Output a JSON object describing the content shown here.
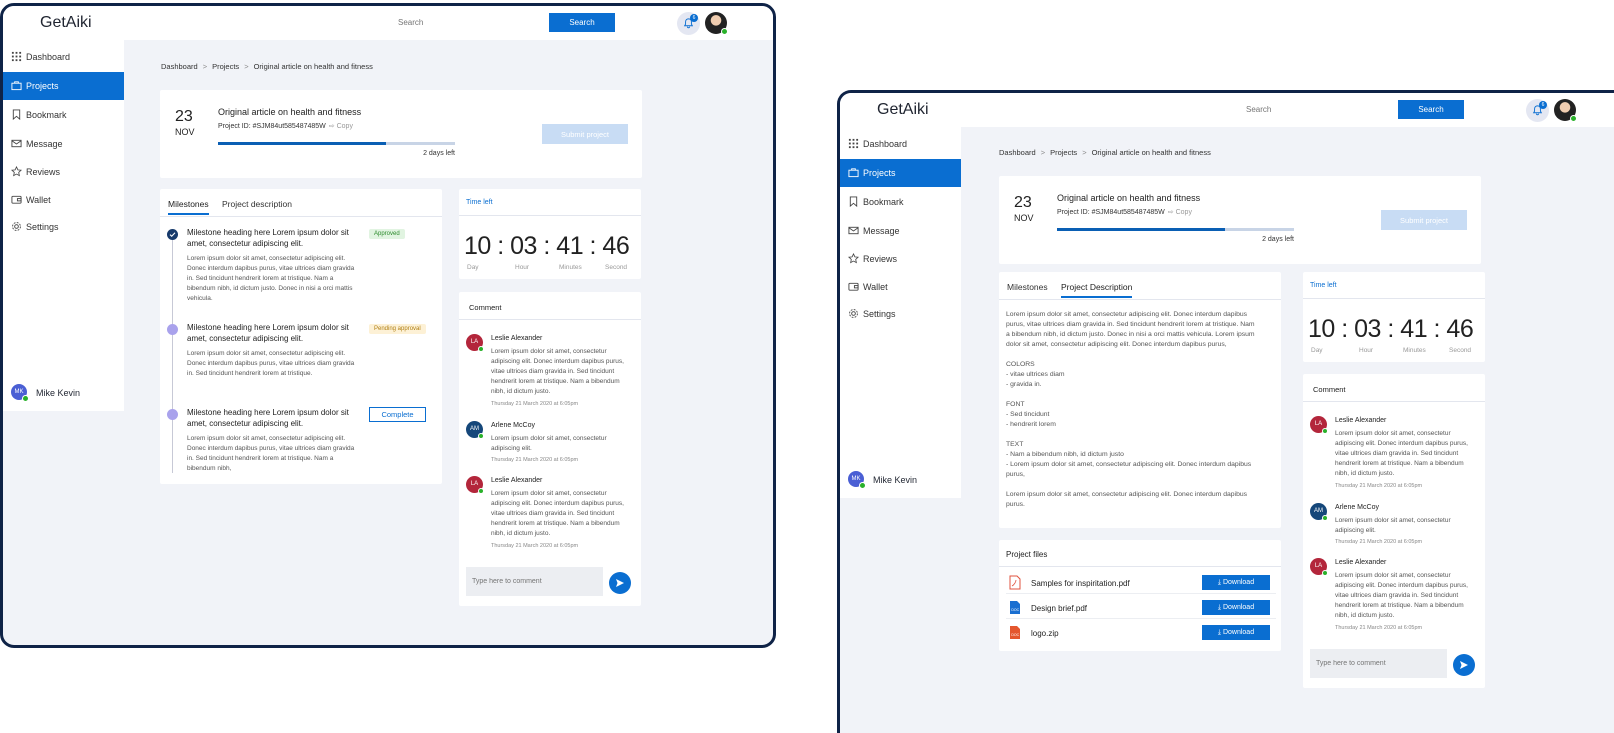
{
  "app": {
    "title": "GetAiki"
  },
  "search": {
    "placeholder": "Search",
    "button": "Search"
  },
  "notifications": {
    "count": "6"
  },
  "sidebar": {
    "items": [
      {
        "label": "Dashboard",
        "icon": "grid-icon"
      },
      {
        "label": "Projects",
        "icon": "briefcase-icon"
      },
      {
        "label": "Bookmark",
        "icon": "bookmark-icon"
      },
      {
        "label": "Message",
        "icon": "mail-icon"
      },
      {
        "label": "Reviews",
        "icon": "star-icon"
      },
      {
        "label": "Wallet",
        "icon": "wallet-icon"
      },
      {
        "label": "Settings",
        "icon": "gear-icon"
      }
    ],
    "user": {
      "initials": "MK",
      "name": "Mike Kevin"
    }
  },
  "breadcrumb": [
    "Dashboard",
    "Projects",
    "Original article on health and fitness"
  ],
  "project": {
    "day": "23",
    "month": "NOV",
    "title": "Original article on health and fitness",
    "id_text": "Project ID: #SJM84ut585487485W",
    "copy_label": "Copy",
    "progress": 0.71,
    "days_left": "2 days left",
    "submit_label": "Submit project"
  },
  "tabs": {
    "milestones": "Milestones",
    "description_left": "Project description",
    "description_right": "Project Description"
  },
  "milestones": [
    {
      "heading": "Milestone heading here Lorem ipsum dolor sit amet, consectetur adipiscing elit.",
      "body": "Lorem ipsum dolor sit amet, consectetur adipiscing elit. Donec interdum dapibus purus, vitae ultrices diam gravida in. Sed tincidunt hendrerit lorem at tristique. Nam a bibendum nibh, id dictum justo. Donec in nisi a orci mattis vehicula.",
      "status": "Approved"
    },
    {
      "heading": "Milestone heading here Lorem ipsum dolor sit amet, consectetur adipiscing elit.",
      "body": "Lorem ipsum dolor sit amet, consectetur adipiscing elit. Donec interdum dapibus purus, vitae ultrices diam gravida in. Sed tincidunt hendrerit lorem at tristique.",
      "status": "Pending approval"
    },
    {
      "heading": "Milestone heading here Lorem ipsum dolor sit amet, consectetur adipiscing elit.",
      "body": "Lorem ipsum dolor sit amet, consectetur adipiscing elit. Donec interdum dapibus purus, vitae ultrices diam gravida in. Sed tincidunt hendrerit lorem at tristique. Nam a bibendum nibh,",
      "action": "Complete"
    }
  ],
  "timer": {
    "title": "Time left",
    "display": "10 : 03 : 41 : 46",
    "labels": [
      "Day",
      "Hour",
      "Minutes",
      "Second"
    ]
  },
  "comments": {
    "title": "Comment",
    "items": [
      {
        "initials": "LA",
        "name": "Leslie Alexander",
        "text": "Lorem ipsum dolor sit amet, consectetur adipiscing elit. Donec interdum dapibus purus, vitae ultrices diam gravida in. Sed tincidunt hendrerit lorem at tristique. Nam a bibendum nibh, id dictum justo.",
        "time": "Thursday 21 March 2020 at 6:05pm"
      },
      {
        "initials": "AM",
        "name": "Arlene McCoy",
        "text": "Lorem ipsum dolor sit amet, consectetur adipiscing elit.",
        "time": "Thursday 21 March 2020 at 6:05pm"
      },
      {
        "initials": "LA",
        "name": "Leslie Alexander",
        "text": "Lorem ipsum dolor sit amet, consectetur adipiscing elit. Donec interdum dapibus purus, vitae ultrices diam gravida in. Sed tincidunt hendrerit lorem at tristique. Nam a bibendum nibh, id dictum justo.",
        "time": "Thursday 21 March 2020 at 6:05pm"
      }
    ],
    "input_placeholder": "Type here to comment"
  },
  "description": {
    "text": "Lorem ipsum dolor sit amet, consectetur adipiscing elit. Donec interdum dapibus purus, vitae ultrices diam gravida in. Sed tincidunt hendrerit lorem at tristique. Nam a bibendum nibh, id dictum justo. Donec in nisi a orci mattis vehicula. Lorem ipsum dolor sit amet, consectetur adipiscing elit. Donec interdum dapibus purus,\n\nCOLORS\n- vitae ultrices diam\n- gravida in.\n\nFONT\n- Sed tincidunt\n- hendrerit lorem\n\nTEXT\n- Nam a bibendum nibh, id dictum justo\n- Lorem ipsum dolor sit amet, consectetur adipiscing elit. Donec interdum dapibus purus,\n\nLorem ipsum dolor sit amet, consectetur adipiscing elit. Donec interdum dapibus purus."
  },
  "files": {
    "title": "Project files",
    "items": [
      {
        "name": "Samples for inspiritation.pdf",
        "icon": "pdf-file-icon"
      },
      {
        "name": "Design brief.pdf",
        "icon": "doc-file-icon"
      },
      {
        "name": "logo.zip",
        "icon": "zip-file-icon"
      }
    ],
    "download_label": "Download"
  },
  "colors": {
    "primary": "#0a6ed1",
    "navy": "#0f2347",
    "background": "#f1f3f8"
  }
}
